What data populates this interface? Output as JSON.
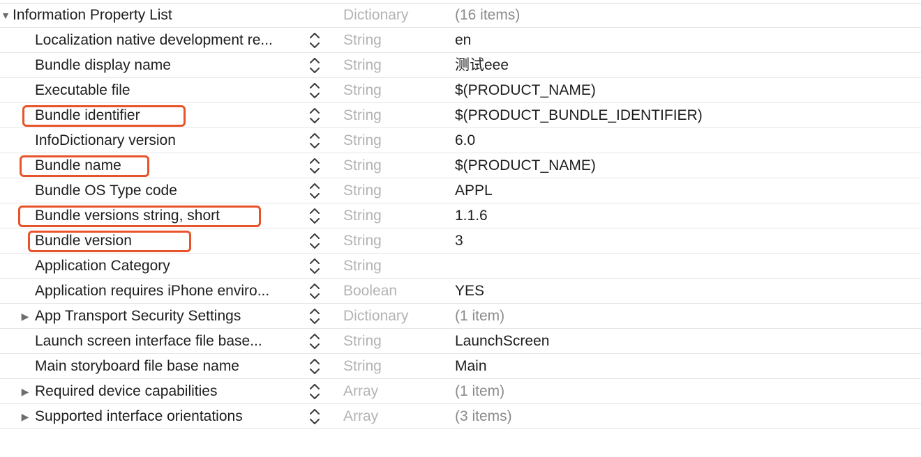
{
  "root": {
    "key": "Information Property List",
    "type": "Dictionary",
    "value": "(16 items)"
  },
  "rows": [
    {
      "key": "Localization native development re...",
      "type": "String",
      "value": "en",
      "expandable": false
    },
    {
      "key": "Bundle display name",
      "type": "String",
      "value": "测试eee",
      "expandable": false
    },
    {
      "key": "Executable file",
      "type": "String",
      "value": "$(PRODUCT_NAME)",
      "expandable": false
    },
    {
      "key": "Bundle identifier",
      "type": "String",
      "value": "$(PRODUCT_BUNDLE_IDENTIFIER)",
      "expandable": false,
      "highlighted": true
    },
    {
      "key": "InfoDictionary version",
      "type": "String",
      "value": "6.0",
      "expandable": false
    },
    {
      "key": "Bundle name",
      "type": "String",
      "value": "$(PRODUCT_NAME)",
      "expandable": false,
      "highlighted": true
    },
    {
      "key": "Bundle OS Type code",
      "type": "String",
      "value": "APPL",
      "expandable": false
    },
    {
      "key": "Bundle versions string, short",
      "type": "String",
      "value": "1.1.6",
      "expandable": false,
      "highlighted": true
    },
    {
      "key": "Bundle version",
      "type": "String",
      "value": "3",
      "expandable": false,
      "highlighted": true
    },
    {
      "key": "Application Category",
      "type": "String",
      "value": "",
      "expandable": false
    },
    {
      "key": "Application requires iPhone enviro...",
      "type": "Boolean",
      "value": "YES",
      "expandable": false
    },
    {
      "key": "App Transport Security Settings",
      "type": "Dictionary",
      "value": "(1 item)",
      "expandable": true
    },
    {
      "key": "Launch screen interface file base...",
      "type": "String",
      "value": "LaunchScreen",
      "expandable": false
    },
    {
      "key": "Main storyboard file base name",
      "type": "String",
      "value": "Main",
      "expandable": false
    },
    {
      "key": "Required device capabilities",
      "type": "Array",
      "value": "(1 item)",
      "expandable": true
    },
    {
      "key": "Supported interface orientations",
      "type": "Array",
      "value": "(3 items)",
      "expandable": true
    }
  ],
  "icons": {
    "expanded": "disclosure-triangle-down-icon",
    "collapsed": "disclosure-triangle-right-icon",
    "stepper": "up-down-stepper-icon"
  },
  "colors": {
    "highlight": "#e8542a",
    "type_text": "#b3b3b3",
    "muted_value": "#8a8a8a"
  }
}
